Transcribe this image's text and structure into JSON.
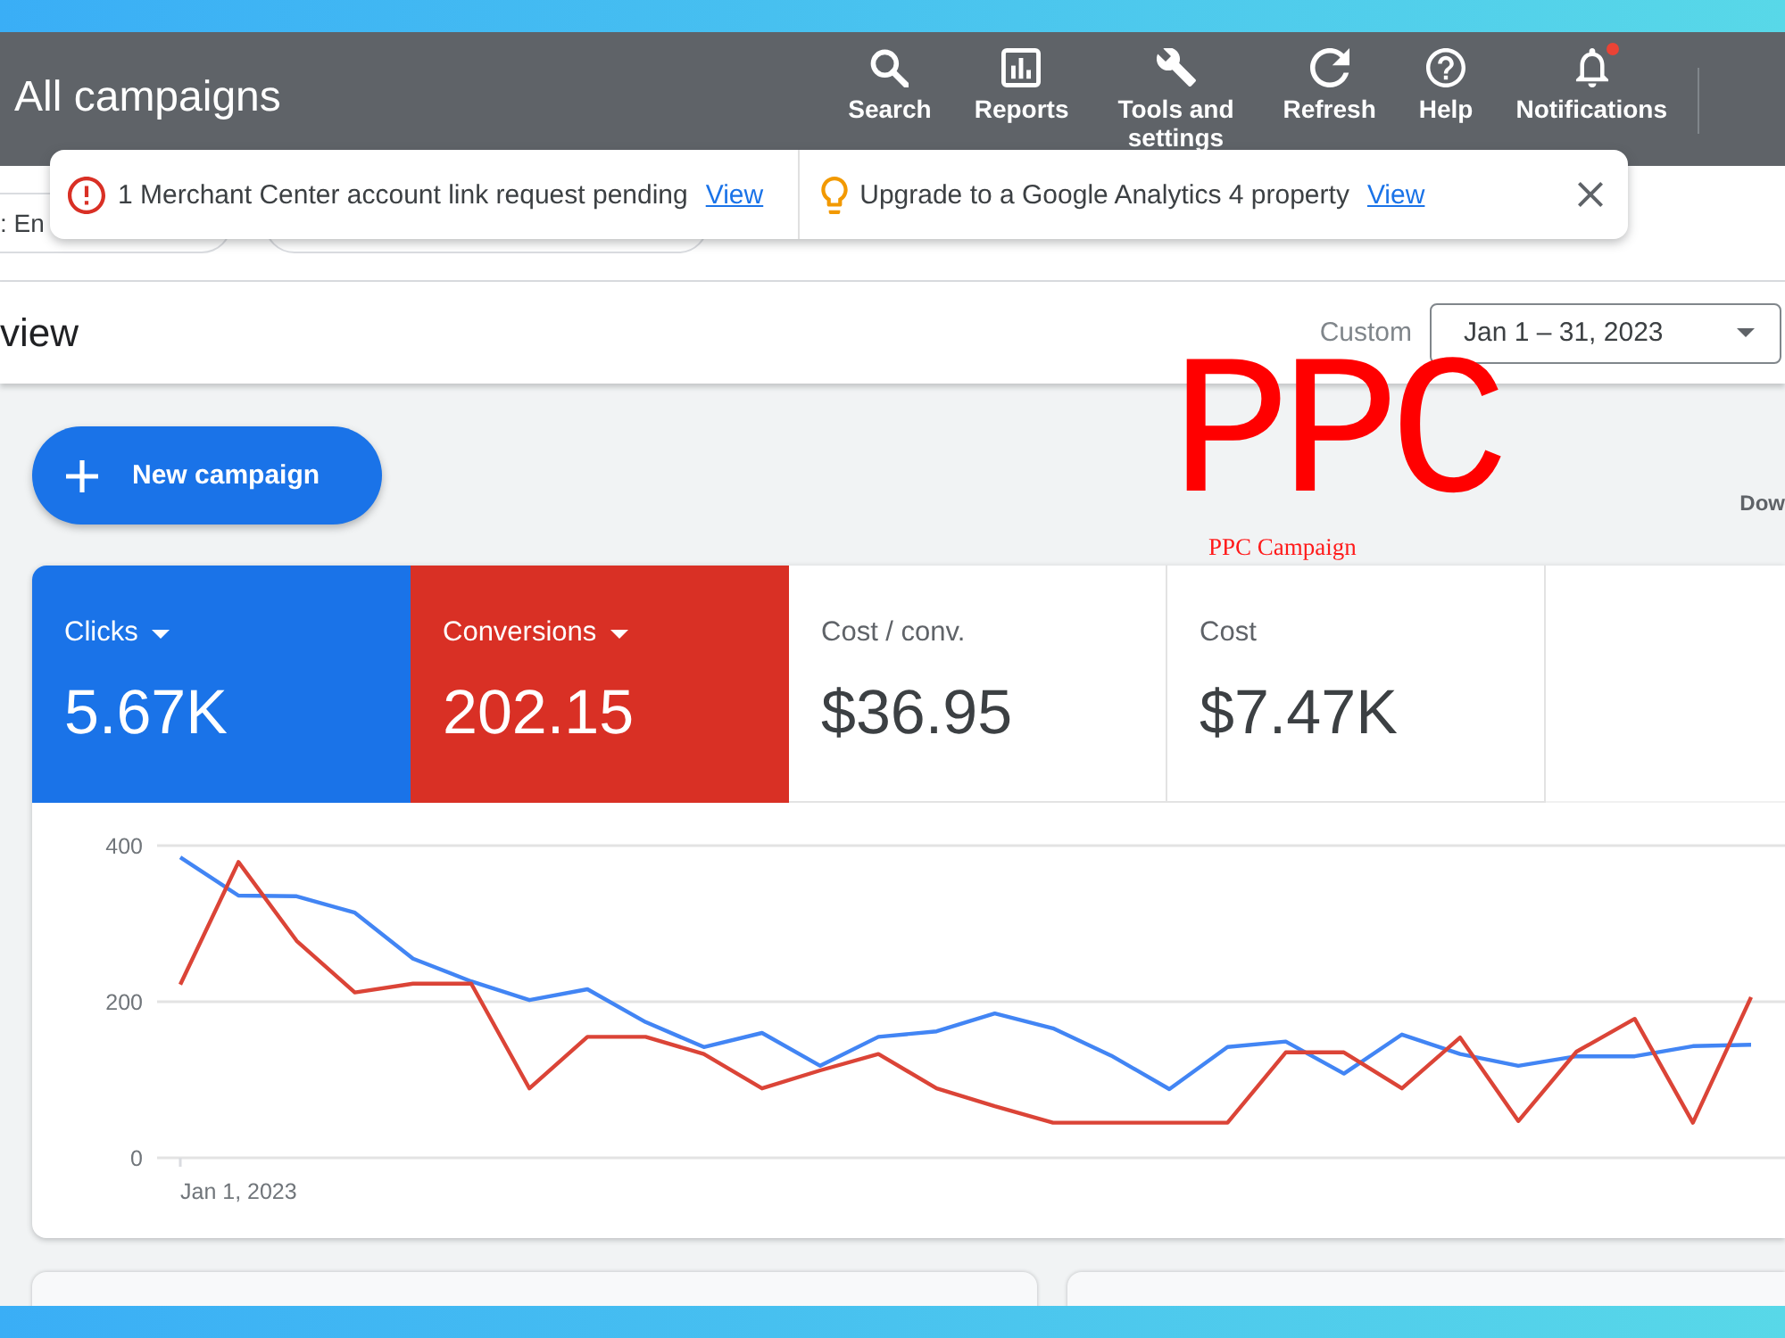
{
  "header": {
    "title": "All campaigns",
    "toolbar": [
      {
        "kind": "search",
        "label": "Search",
        "unread": false
      },
      {
        "kind": "reports",
        "label": "Reports",
        "unread": false
      },
      {
        "kind": "tools",
        "label": "Tools and settings",
        "unread": false
      },
      {
        "kind": "refresh",
        "label": "Refresh",
        "unread": false
      },
      {
        "kind": "help",
        "label": "Help",
        "unread": false
      },
      {
        "kind": "notifications",
        "label": "Notifications",
        "unread": true
      }
    ]
  },
  "notices": [
    {
      "kind": "error",
      "text": "1 Merchant Center account link request pending",
      "link": "View"
    },
    {
      "kind": "tip",
      "text": "Upgrade to a Google Analytics 4 property",
      "link": "View"
    }
  ],
  "filter_chips": [
    {
      "label": ": En"
    }
  ],
  "overview_bar": {
    "title": "view",
    "date_label": "Custom",
    "date_range": "Jan 1 – 31, 2023"
  },
  "actions": {
    "new_campaign": "New campaign",
    "side_button": "Dow"
  },
  "annotation": {
    "handwriting": "PPC",
    "label": "PPC Campaign"
  },
  "metrics_card": {
    "metrics": [
      {
        "label": "Clicks",
        "value": "5.67K",
        "selected": true,
        "color": "#1a73e8"
      },
      {
        "label": "Conversions",
        "value": "202.15",
        "selected": true,
        "color": "#d93025"
      },
      {
        "label": "Cost / conv.",
        "value": "$36.95",
        "selected": false
      },
      {
        "label": "Cost",
        "value": "$7.47K",
        "selected": false
      }
    ],
    "chart_data": {
      "type": "line",
      "ylim": [
        0,
        400
      ],
      "yticks": [
        0,
        200,
        400
      ],
      "annotations": [
        {
          "text": "Jan 1, 2023"
        }
      ],
      "series": [
        {
          "color": "#4285f4",
          "values": [
            385,
            336,
            335,
            314,
            255,
            226,
            202,
            216,
            174,
            142,
            160,
            118,
            155,
            162,
            185,
            166,
            131,
            88,
            142,
            149,
            108,
            158,
            133,
            118,
            130,
            130,
            143,
            145
          ]
        },
        {
          "color": "#db4437",
          "values": [
            222,
            379,
            278,
            212,
            223,
            223,
            89,
            155,
            155,
            133,
            89,
            112,
            133,
            89,
            66,
            45,
            45,
            45,
            45,
            135,
            135,
            89,
            154,
            47,
            136,
            178,
            45,
            206
          ]
        }
      ]
    }
  }
}
